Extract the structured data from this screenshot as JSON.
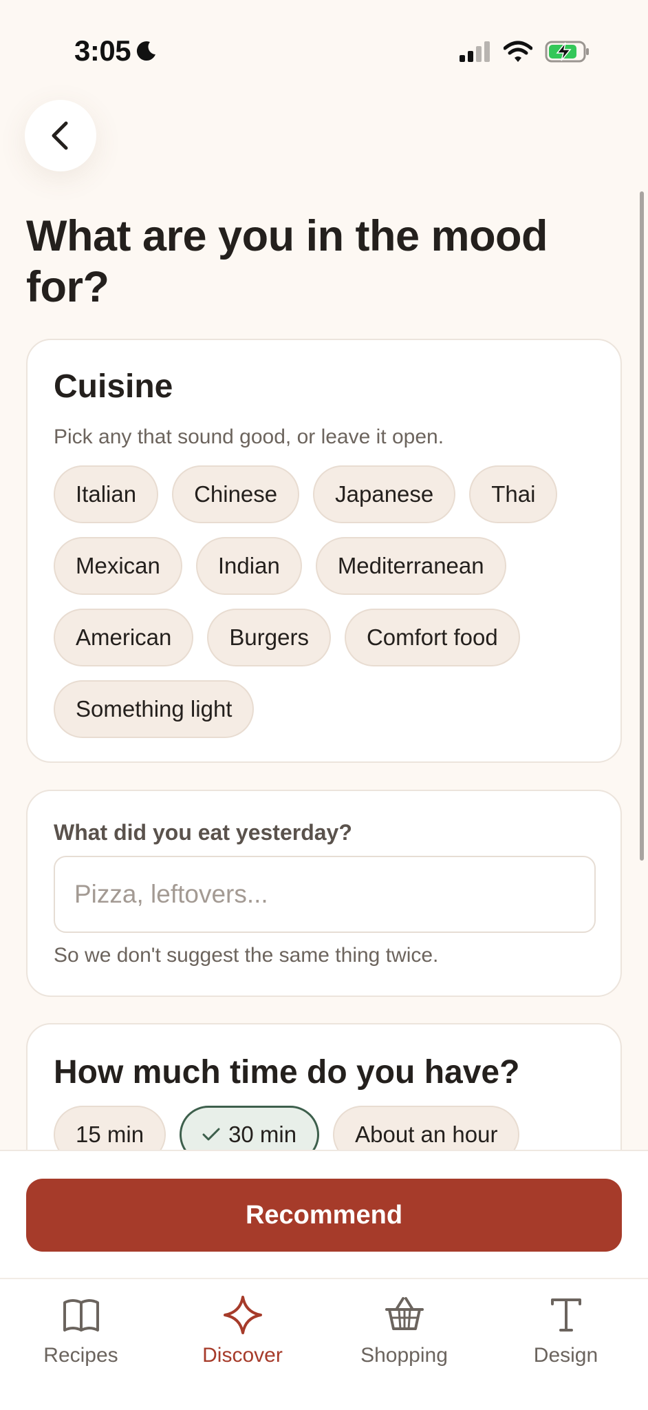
{
  "status_bar": {
    "time": "3:05"
  },
  "page": {
    "title": "What are you in the mood for?"
  },
  "cuisine": {
    "title": "Cuisine",
    "subtitle": "Pick any that sound good, or leave it open.",
    "options": [
      {
        "label": "Italian",
        "selected": false
      },
      {
        "label": "Chinese",
        "selected": false
      },
      {
        "label": "Japanese",
        "selected": false
      },
      {
        "label": "Thai",
        "selected": false
      },
      {
        "label": "Mexican",
        "selected": false
      },
      {
        "label": "Indian",
        "selected": false
      },
      {
        "label": "Mediterranean",
        "selected": false
      },
      {
        "label": "American",
        "selected": false
      },
      {
        "label": "Burgers",
        "selected": false
      },
      {
        "label": "Comfort food",
        "selected": false
      },
      {
        "label": "Something light",
        "selected": false
      }
    ]
  },
  "yesterday": {
    "label": "What did you eat yesterday?",
    "value": "",
    "placeholder": "Pizza, leftovers...",
    "helper": "So we don't suggest the same thing twice."
  },
  "time": {
    "title": "How much time do you have?",
    "options": [
      {
        "label": "15 min",
        "selected": false
      },
      {
        "label": "30 min",
        "selected": true
      },
      {
        "label": "About an hour",
        "selected": false
      }
    ]
  },
  "actions": {
    "recommend_label": "Recommend"
  },
  "tabs": [
    {
      "label": "Recipes",
      "icon": "book-icon",
      "active": false
    },
    {
      "label": "Discover",
      "icon": "sparkle-icon",
      "active": true
    },
    {
      "label": "Shopping",
      "icon": "basket-icon",
      "active": false
    },
    {
      "label": "Design",
      "icon": "typography-icon",
      "active": false
    }
  ],
  "colors": {
    "accent": "#a63b2a",
    "background": "#fdf8f3",
    "selected_chip_border": "#3d5f4c",
    "selected_chip_fill": "#e8efe9",
    "battery_fill": "#34c759"
  }
}
